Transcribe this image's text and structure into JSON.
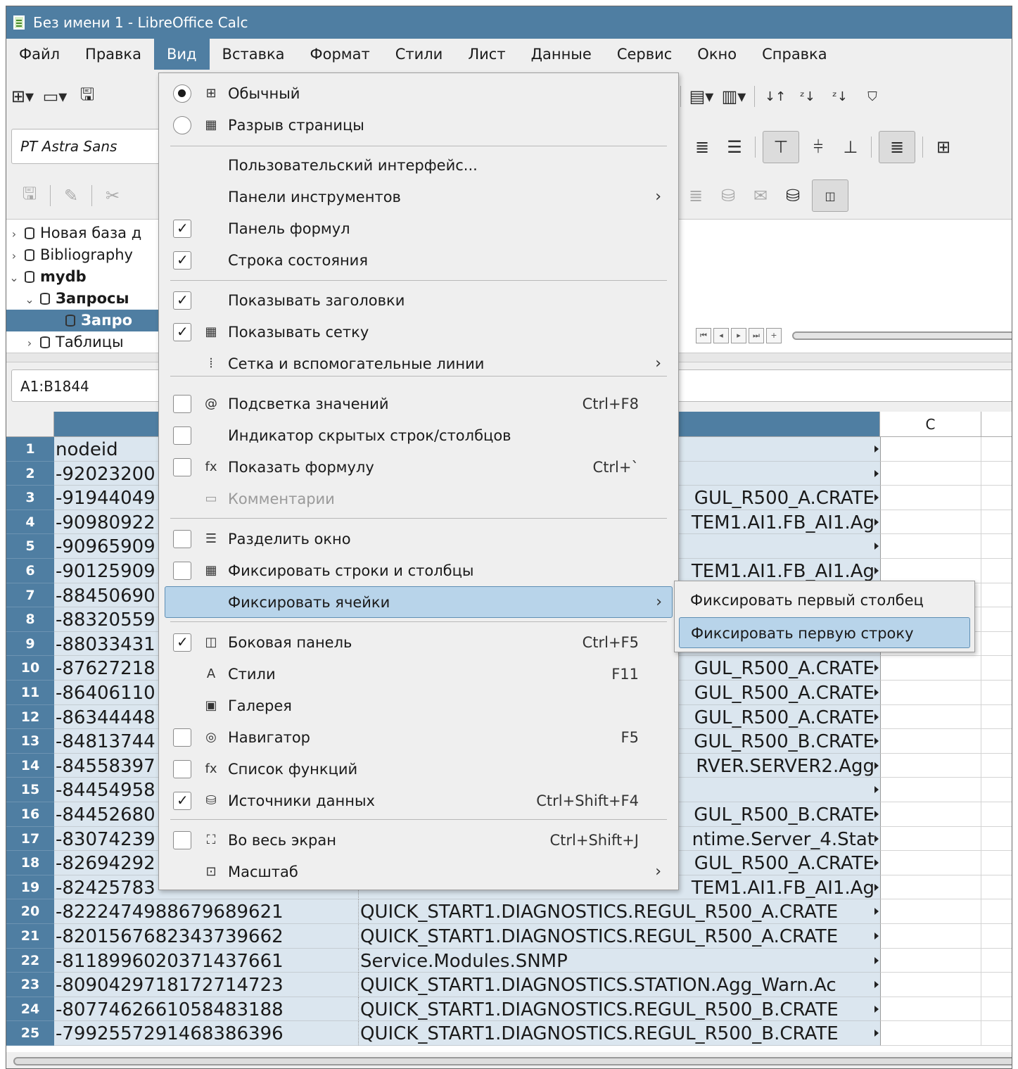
{
  "window": {
    "title": "Без имени 1 - LibreOffice Calc"
  },
  "menubar": [
    "Файл",
    "Правка",
    "Вид",
    "Вставка",
    "Формат",
    "Стили",
    "Лист",
    "Данные",
    "Сервис",
    "Окно",
    "Справка"
  ],
  "toolbar": {
    "font_name": "PT Astra Sans"
  },
  "datasources": {
    "items": [
      {
        "label": "Новая база д",
        "bold": false,
        "selected": false
      },
      {
        "label": "Bibliography",
        "bold": false,
        "selected": false
      },
      {
        "label": "mydb",
        "bold": true,
        "selected": false
      },
      {
        "label": "Запросы",
        "bold": true,
        "selected": false
      },
      {
        "label": "Запро",
        "bold": true,
        "selected": true
      },
      {
        "label": "Таблицы",
        "bold": false,
        "selected": false
      }
    ]
  },
  "formula_bar": {
    "name_box": "A1:B1844",
    "input": ""
  },
  "sheet": {
    "column_c": "C",
    "rows": [
      {
        "n": "1",
        "a": "nodeid",
        "b": ""
      },
      {
        "n": "2",
        "a": "-92023200",
        "b": ""
      },
      {
        "n": "3",
        "a": "-91944049",
        "b": "GUL_R500_A.CRATE"
      },
      {
        "n": "4",
        "a": "-90980922",
        "b": "TEM1.AI1.FB_AI1.Ag"
      },
      {
        "n": "5",
        "a": "-90965909",
        "b": ""
      },
      {
        "n": "6",
        "a": "-90125909",
        "b": "TEM1.AI1.FB_AI1.Ag"
      },
      {
        "n": "7",
        "a": "-88450690",
        "b": ""
      },
      {
        "n": "8",
        "a": "-88320559",
        "b": ""
      },
      {
        "n": "9",
        "a": "-88033431",
        "b": ""
      },
      {
        "n": "10",
        "a": "-87627218",
        "b": "GUL_R500_A.CRATE"
      },
      {
        "n": "11",
        "a": "-86406110",
        "b": "GUL_R500_A.CRATE"
      },
      {
        "n": "12",
        "a": "-86344448",
        "b": "GUL_R500_A.CRATE"
      },
      {
        "n": "13",
        "a": "-84813744",
        "b": "GUL_R500_B.CRATE"
      },
      {
        "n": "14",
        "a": "-84558397",
        "b": "RVER.SERVER2.Agg"
      },
      {
        "n": "15",
        "a": "-84454958",
        "b": ""
      },
      {
        "n": "16",
        "a": "-84452680",
        "b": "GUL_R500_B.CRATE"
      },
      {
        "n": "17",
        "a": "-83074239",
        "b": "ntime.Server_4.Stat"
      },
      {
        "n": "18",
        "a": "-82694292",
        "b": "GUL_R500_A.CRATE"
      },
      {
        "n": "19",
        "a": "-82425783",
        "b": "TEM1.AI1.FB_AI1.Ag"
      },
      {
        "n": "20",
        "a": "-8222474988679689621",
        "b": "QUICK_START1.DIAGNOSTICS.REGUL_R500_A.CRATE"
      },
      {
        "n": "21",
        "a": "-8201567682343739662",
        "b": "QUICK_START1.DIAGNOSTICS.REGUL_R500_A.CRATE"
      },
      {
        "n": "22",
        "a": "-8118996020371437661",
        "b": "Service.Modules.SNMP"
      },
      {
        "n": "23",
        "a": "-8090429718172714723",
        "b": "QUICK_START1.DIAGNOSTICS.STATION.Agg_Warn.Ac"
      },
      {
        "n": "24",
        "a": "-8077462661058483188",
        "b": "QUICK_START1.DIAGNOSTICS.REGUL_R500_B.CRATE"
      },
      {
        "n": "25",
        "a": "-7992557291468386396",
        "b": "QUICK_START1.DIAGNOSTICS.REGUL_R500_B.CRATE"
      }
    ]
  },
  "view_menu": {
    "items": [
      {
        "type": "item",
        "ind": "radio-on",
        "icon": "⊞",
        "label": "Обычный"
      },
      {
        "type": "item",
        "ind": "radio-off",
        "icon": "▦",
        "label": "Разрыв страницы"
      },
      {
        "type": "sep"
      },
      {
        "type": "item",
        "ind": "none",
        "icon": "",
        "label": "Пользовательский интерфейс..."
      },
      {
        "type": "item",
        "ind": "none",
        "icon": "",
        "label": "Панели инструментов",
        "submenu": true
      },
      {
        "type": "item",
        "ind": "check-on",
        "icon": "",
        "label": "Панель формул"
      },
      {
        "type": "item",
        "ind": "check-on",
        "icon": "",
        "label": "Строка состояния"
      },
      {
        "type": "sep"
      },
      {
        "type": "item",
        "ind": "check-on",
        "icon": "",
        "label": "Показывать заголовки"
      },
      {
        "type": "item",
        "ind": "check-on",
        "icon": "▦",
        "label": "Показывать сетку"
      },
      {
        "type": "item",
        "ind": "none",
        "icon": "⦙",
        "label": "Сетка и вспомогательные линии",
        "submenu": true
      },
      {
        "type": "sep"
      },
      {
        "type": "item",
        "ind": "check-off",
        "icon": "@",
        "label": "Подсветка значений",
        "shortcut": "Ctrl+F8"
      },
      {
        "type": "item",
        "ind": "check-off",
        "icon": "",
        "label": "Индикатор скрытых строк/столбцов"
      },
      {
        "type": "item",
        "ind": "check-off",
        "icon": "fx",
        "label": "Показать формулу",
        "shortcut": "Ctrl+`"
      },
      {
        "type": "item",
        "ind": "none",
        "icon": "▭",
        "label": "Комментарии",
        "disabled": true
      },
      {
        "type": "sep"
      },
      {
        "type": "item",
        "ind": "check-off",
        "icon": "☰",
        "label": "Разделить окно"
      },
      {
        "type": "item",
        "ind": "check-off",
        "icon": "▦",
        "label": "Фиксировать строки и столбцы"
      },
      {
        "type": "item",
        "ind": "none",
        "icon": "",
        "label": "Фиксировать ячейки",
        "submenu": true,
        "highlighted": true
      },
      {
        "type": "sep"
      },
      {
        "type": "item",
        "ind": "check-on",
        "icon": "◫",
        "label": "Боковая панель",
        "shortcut": "Ctrl+F5"
      },
      {
        "type": "item",
        "ind": "none",
        "icon": "A",
        "label": "Стили",
        "shortcut": "F11"
      },
      {
        "type": "item",
        "ind": "none",
        "icon": "▣",
        "label": "Галерея"
      },
      {
        "type": "item",
        "ind": "check-off",
        "icon": "◎",
        "label": "Навигатор",
        "shortcut": "F5"
      },
      {
        "type": "item",
        "ind": "check-off",
        "icon": "fx",
        "label": "Список функций"
      },
      {
        "type": "item",
        "ind": "check-on",
        "icon": "⛁",
        "label": "Источники данных",
        "shortcut": "Ctrl+Shift+F4"
      },
      {
        "type": "sep"
      },
      {
        "type": "item",
        "ind": "check-off",
        "icon": "⛶",
        "label": "Во весь экран",
        "shortcut": "Ctrl+Shift+J"
      },
      {
        "type": "item",
        "ind": "none",
        "icon": "⊡",
        "label": "Масштаб",
        "submenu": true
      }
    ],
    "freeze_submenu": [
      {
        "label": "Фиксировать первый столбец",
        "highlighted": false
      },
      {
        "label": "Фиксировать первую строку",
        "highlighted": true
      }
    ]
  }
}
